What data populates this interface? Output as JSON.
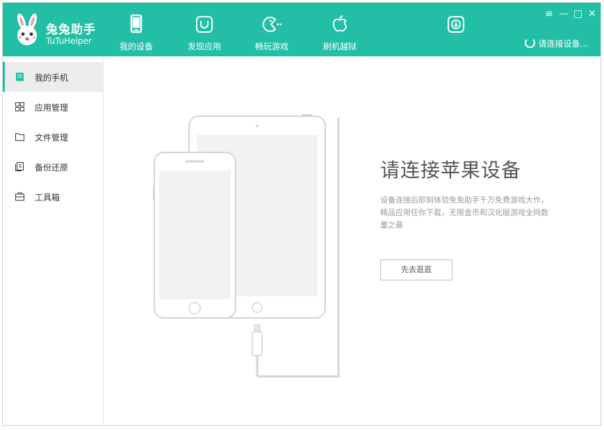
{
  "app": {
    "name_cn": "兔兔助手",
    "name_en": "TuTuHelper"
  },
  "nav": [
    {
      "label": "我的设备",
      "icon": "phone-icon"
    },
    {
      "label": "发现应用",
      "icon": "bag-icon"
    },
    {
      "label": "畅玩游戏",
      "icon": "gamepad-icon"
    },
    {
      "label": "刷机越狱",
      "icon": "apple-icon"
    },
    {
      "label": "",
      "icon": "download-icon"
    }
  ],
  "window_controls": {
    "menu": "≡",
    "min": "—",
    "max": "□",
    "close": "✕"
  },
  "connect_status": "请连接设备...",
  "sidebar": [
    {
      "label": "我的手机",
      "icon": "book-icon",
      "active": true
    },
    {
      "label": "应用管理",
      "icon": "grid-icon",
      "active": false
    },
    {
      "label": "文件管理",
      "icon": "folder-icon",
      "active": false
    },
    {
      "label": "备份还原",
      "icon": "backup-icon",
      "active": false
    },
    {
      "label": "工具箱",
      "icon": "toolbox-icon",
      "active": false
    }
  ],
  "main": {
    "title": "请连接苹果设备",
    "description": "设备连接后即刻体验免免助手千万免费游戏大作，精品应用任你下载，无限金币和汉化版游戏全网数量之最",
    "button_label": "先去逛逛"
  },
  "colors": {
    "accent": "#22bfa6"
  }
}
